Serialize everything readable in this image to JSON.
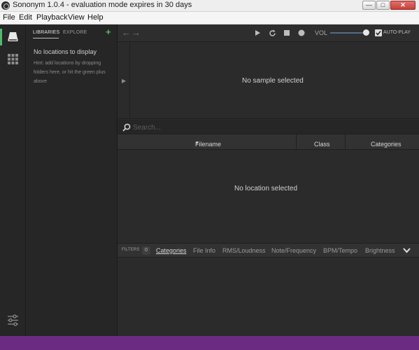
{
  "titlebar": {
    "title": "Sononym 1.0.4 - evaluation mode expires in 30 days"
  },
  "menu": [
    "File",
    "Edit",
    "Playback",
    "View",
    "Help"
  ],
  "rail": {
    "icons": [
      "libraries-icon",
      "grid-icon",
      "sliders-icon"
    ],
    "accent": "#4dbb6b"
  },
  "sidepanel": {
    "tabs": [
      "LIBRARIES",
      "EXPLORE"
    ],
    "add_symbol": "+",
    "empty_title": "No locations to display",
    "hint": "Hint: add locations by dropping folders here, or hit the green plus above"
  },
  "toolbar": {
    "volume_label": "VOL",
    "volume_level": 0.9,
    "autoplay_label": "AUTO-PLAY",
    "autoplay_checked": true
  },
  "waveform": {
    "empty_text": "No sample selected"
  },
  "search": {
    "placeholder": "Search..."
  },
  "table": {
    "columns": [
      "Filename",
      "Class",
      "Categories"
    ],
    "sort_column": "Filename",
    "empty_text": "No location selected"
  },
  "filters": {
    "label": "FILTERS",
    "count": "0",
    "tabs": [
      "Categories",
      "File Info",
      "RMS/Loudness",
      "Note/Frequency",
      "BPM/Tempo",
      "Brightness"
    ],
    "active_tab": "Categories"
  }
}
